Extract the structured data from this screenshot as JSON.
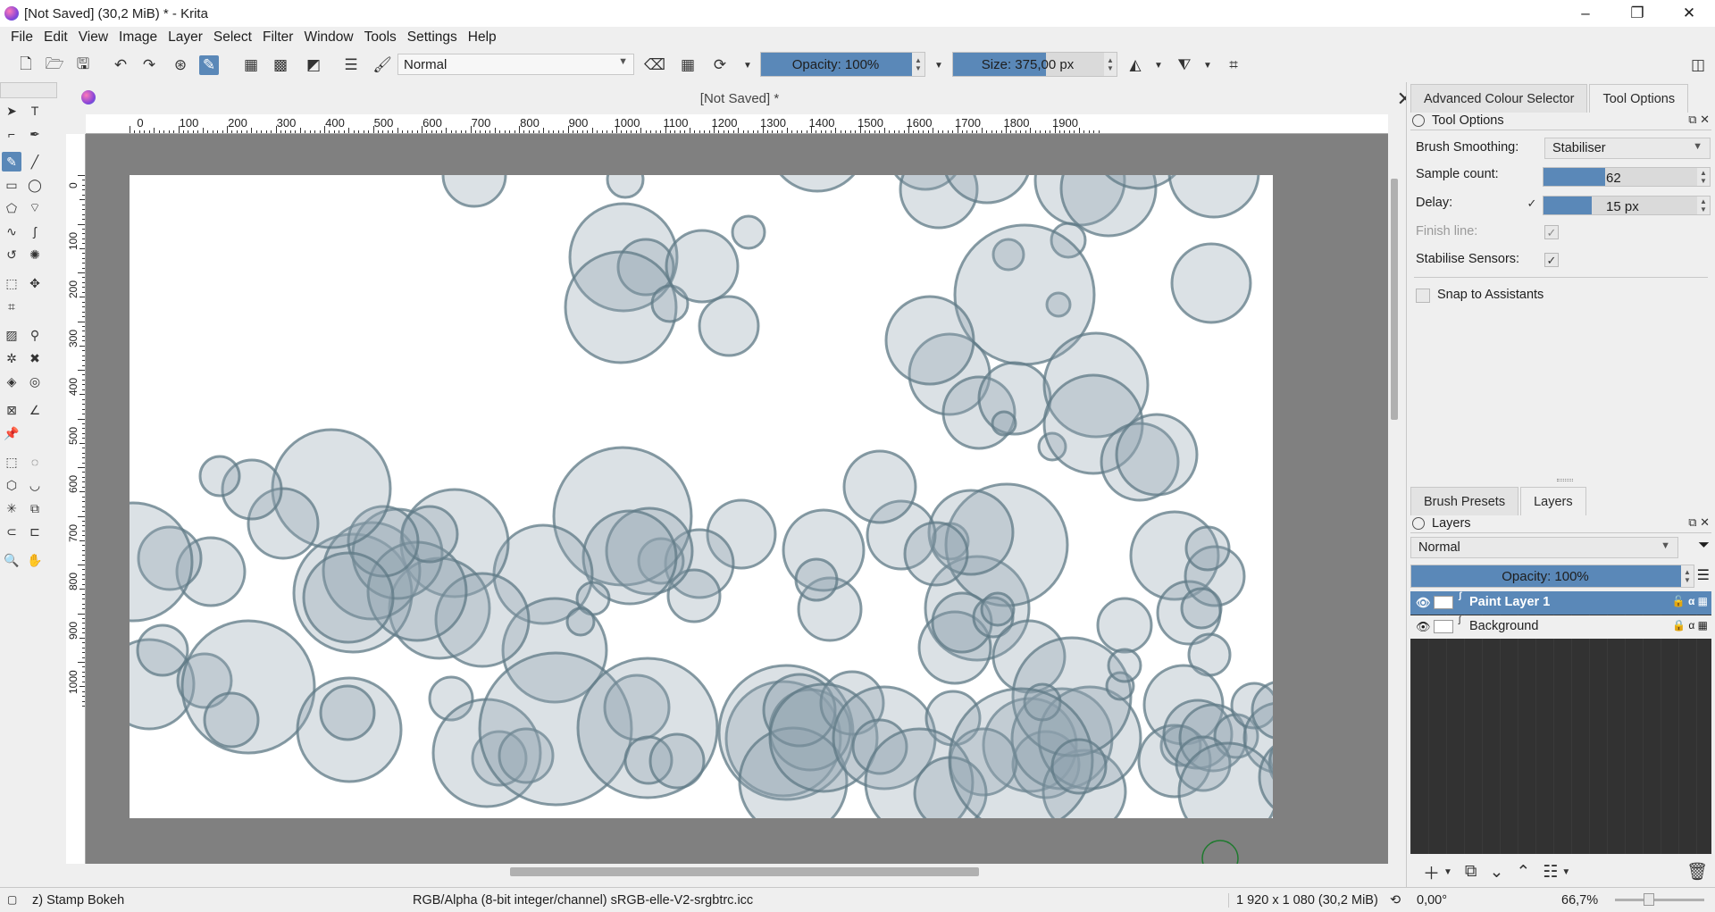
{
  "window": {
    "title": "[Not Saved]  (30,2 MiB)  * - Krita",
    "minimize": "–",
    "maximize": "❐",
    "close": "✕"
  },
  "menu": [
    "File",
    "Edit",
    "View",
    "Image",
    "Layer",
    "Select",
    "Filter",
    "Window",
    "Tools",
    "Settings",
    "Help"
  ],
  "toolbar": {
    "blend_mode": "Normal",
    "opacity_label": "Opacity: 100%",
    "opacity_value": 1.0,
    "size_label": "Size: 375,00 px",
    "size_fill_fraction": 0.57
  },
  "document": {
    "tab_title": "[Not Saved]  *",
    "hruler_labels": [
      "0",
      "100",
      "200",
      "300",
      "400",
      "500",
      "600",
      "700",
      "800",
      "900",
      "1000",
      "1100",
      "1200",
      "1300",
      "1400",
      "1500",
      "1600",
      "1700",
      "1800",
      "1900"
    ],
    "vruler_labels": [
      "0",
      "100",
      "200",
      "300",
      "400",
      "500",
      "600",
      "700",
      "800",
      "900",
      "1000"
    ],
    "canvas_background": "#ffffff",
    "bubble_fill": "#8ea3ad",
    "bubble_stroke": "#5f7a86"
  },
  "dock": {
    "top_tabs": [
      "Advanced Colour Selector",
      "Tool Options"
    ],
    "tool_options": {
      "title": "Tool Options",
      "brush_smoothing_label": "Brush Smoothing:",
      "brush_smoothing_value": "Stabiliser",
      "sample_count_label": "Sample count:",
      "sample_count_value": "62",
      "sample_count_fraction": 0.37,
      "delay_label": "Delay:",
      "delay_value": "15 px",
      "delay_fraction": 0.29,
      "finish_line_label": "Finish line:",
      "stabilise_sensors_label": "Stabilise Sensors:",
      "snap_label": "Snap to Assistants",
      "check": "✓"
    },
    "bottom_tabs": [
      "Brush Presets",
      "Layers"
    ],
    "layers": {
      "title": "Layers",
      "blend_mode": "Normal",
      "opacity_label": "Opacity:  100%",
      "items": [
        {
          "name": "Paint Layer 1"
        },
        {
          "name": "Background"
        }
      ]
    }
  },
  "status": {
    "brush": "z) Stamp Bokeh",
    "color_space": "RGB/Alpha (8-bit integer/channel)  sRGB-elle-V2-srgbtrc.icc",
    "image_size": "1 920 x 1 080 (30,2 MiB)",
    "rotation": "0,00°",
    "zoom": "66,7%"
  },
  "accent": "#5a88b8"
}
